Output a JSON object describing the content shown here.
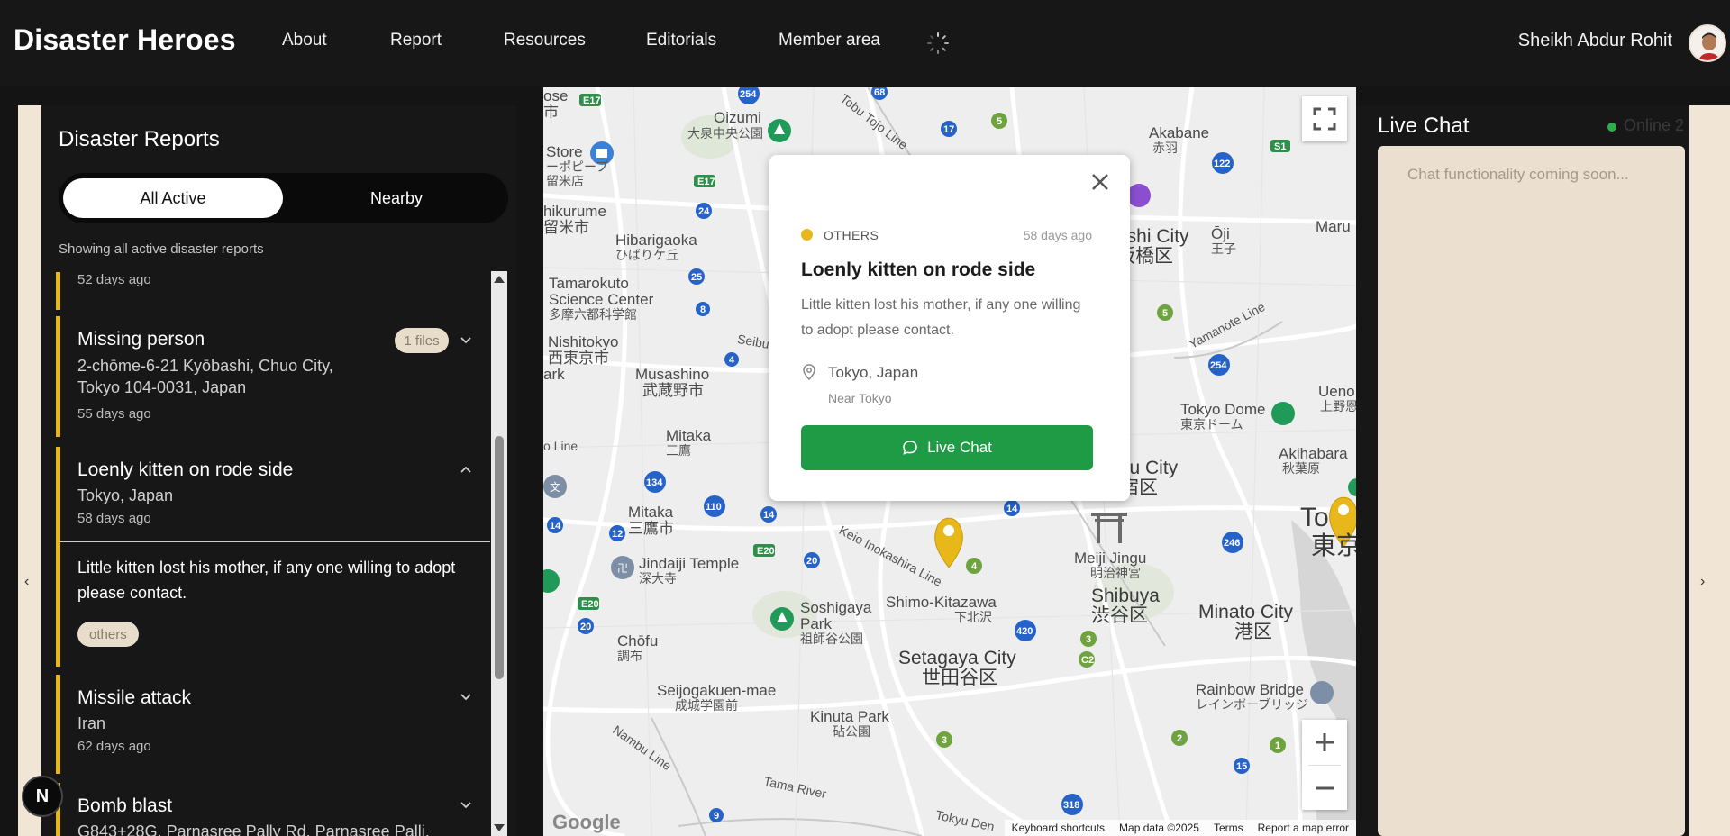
{
  "header": {
    "brand": "Disaster Heroes",
    "nav": [
      "About",
      "Report",
      "Resources",
      "Editorials",
      "Member area"
    ],
    "user_name": "Sheikh Abdur Rohit"
  },
  "sidebar": {
    "title": "Disaster Reports",
    "tabs": {
      "all": "All Active",
      "nearby": "Nearby"
    },
    "showing": "Showing all active disaster reports",
    "reports": [
      {
        "time": "52 days ago"
      },
      {
        "title": "Missing person",
        "location_line1": "2-chōme-6-21 Kyōbashi, Chuo City,",
        "location_line2": "Tokyo 104-0031, Japan",
        "time": "55 days ago",
        "files": "1 files"
      },
      {
        "title": "Loenly kitten on rode side",
        "location": "Tokyo, Japan",
        "time": "58 days ago",
        "description": "Little kitten lost his mother, if any one willing to adopt please contact.",
        "tag": "others"
      },
      {
        "title": "Missile attack",
        "location": "Iran",
        "time": "62 days ago"
      },
      {
        "title": "Bomb blast",
        "location": "G843+28G, Parnasree Pally Rd, Parnasree Palli,"
      }
    ]
  },
  "badge": {
    "letter": "N"
  },
  "map": {
    "labels": {
      "oizumi": "Oizumi",
      "oizumi_jp": "大泉中央公園",
      "akabane": "Akabane",
      "akabane_jp": "赤羽",
      "itabashi": "ashi City",
      "itabashi_jp": "板橋区",
      "oji": "Ōji",
      "oji_jp": "王子",
      "hibarigaoka": "Hibarigaoka",
      "hibarigaoka_jp": "ひばりケ丘",
      "hikurume": "hikurume",
      "hikurume_jp": "留米市",
      "tamarokuto": "Tamarokuto",
      "tamarokuto2": "Science Center",
      "tamarokuto_jp": "多摩六都科学館",
      "nishitokyo": "Nishitokyo",
      "nishitokyo_jp": "西東京市",
      "musashino": "Musashino",
      "musashino_jp": "武蔵野市",
      "mitaka_n": "Mitaka",
      "mitaka_n_jp": "三鷹",
      "mitaka": "Mitaka",
      "mitaka_jp": "三鷹市",
      "jindaiji": "Jindaiji Temple",
      "jindaiji_jp": "深大寺",
      "chofu": "Chōfu",
      "chofu_jp": "調布",
      "soshigaya": "Soshigaya",
      "soshigaya2": "Park",
      "soshigaya_jp": "祖師谷公園",
      "shimokita": "Shimo-Kitazawa",
      "shimokita_jp": "下北沢",
      "setagaya": "Setagaya City",
      "setagaya_jp": "世田谷区",
      "seijo": "Seijogakuen-mae",
      "seijo_jp": "成城学園前",
      "kinuta": "Kinuta Park",
      "kinuta_jp": "砧公園",
      "shibuya": "Shibuya",
      "shibuya_jp": "渋谷区",
      "meiji": "Meiji Jingu",
      "meiji_jp": "明治神宮",
      "shinjuku": "ku City",
      "shinjuku_jp": "宿区",
      "minato": "Minato City",
      "minato_jp": "港区",
      "rainbow": "Rainbow Bridge",
      "rainbow_jp": "レインボーブリッジ",
      "tokyodome": "Tokyo Dome",
      "tokyodome_jp": "東京ドーム",
      "akihabara": "Akihabara",
      "akihabara_jp": "秋葉原",
      "ueno": "Ueno",
      "ueno_jp": "上野恩",
      "to": "To",
      "to_jp": "東京",
      "store": "Store",
      "store_jp": "ーポピープ",
      "store_jp2": "留米店",
      "jose": "ose",
      "jose_jp": "市",
      "ark": "ark",
      "loline": "o Line",
      "maru": "Maru",
      "tobu": "Tobu Tojo Line",
      "seibu": "Seibu Shi",
      "keio": "Keio Inokashira Line",
      "nambu": "Nambu Line",
      "yamanote": "Yamanote Line",
      "tama": "Tama River",
      "tokyu": "Tokyu Den"
    },
    "footer": {
      "shortcuts": "Keyboard shortcuts",
      "mapdata": "Map data ©2025",
      "terms": "Terms",
      "report": "Report a map error"
    },
    "google": "Google"
  },
  "popup": {
    "category": "OTHERS",
    "time": "58 days ago",
    "title": "Loenly kitten on rode side",
    "description": "Little kitten lost his mother, if any one willing to adopt please contact.",
    "location": "Tokyo, Japan",
    "near": "Near Tokyo",
    "button": "Live Chat"
  },
  "chat": {
    "title": "Live Chat",
    "online": "Online 2",
    "placeholder": "Chat functionality coming soon..."
  },
  "colors": {
    "accent": "#e8b71a",
    "button_green": "#1f9a45",
    "beige": "#f1e6d6",
    "online": "#2fae4c"
  }
}
